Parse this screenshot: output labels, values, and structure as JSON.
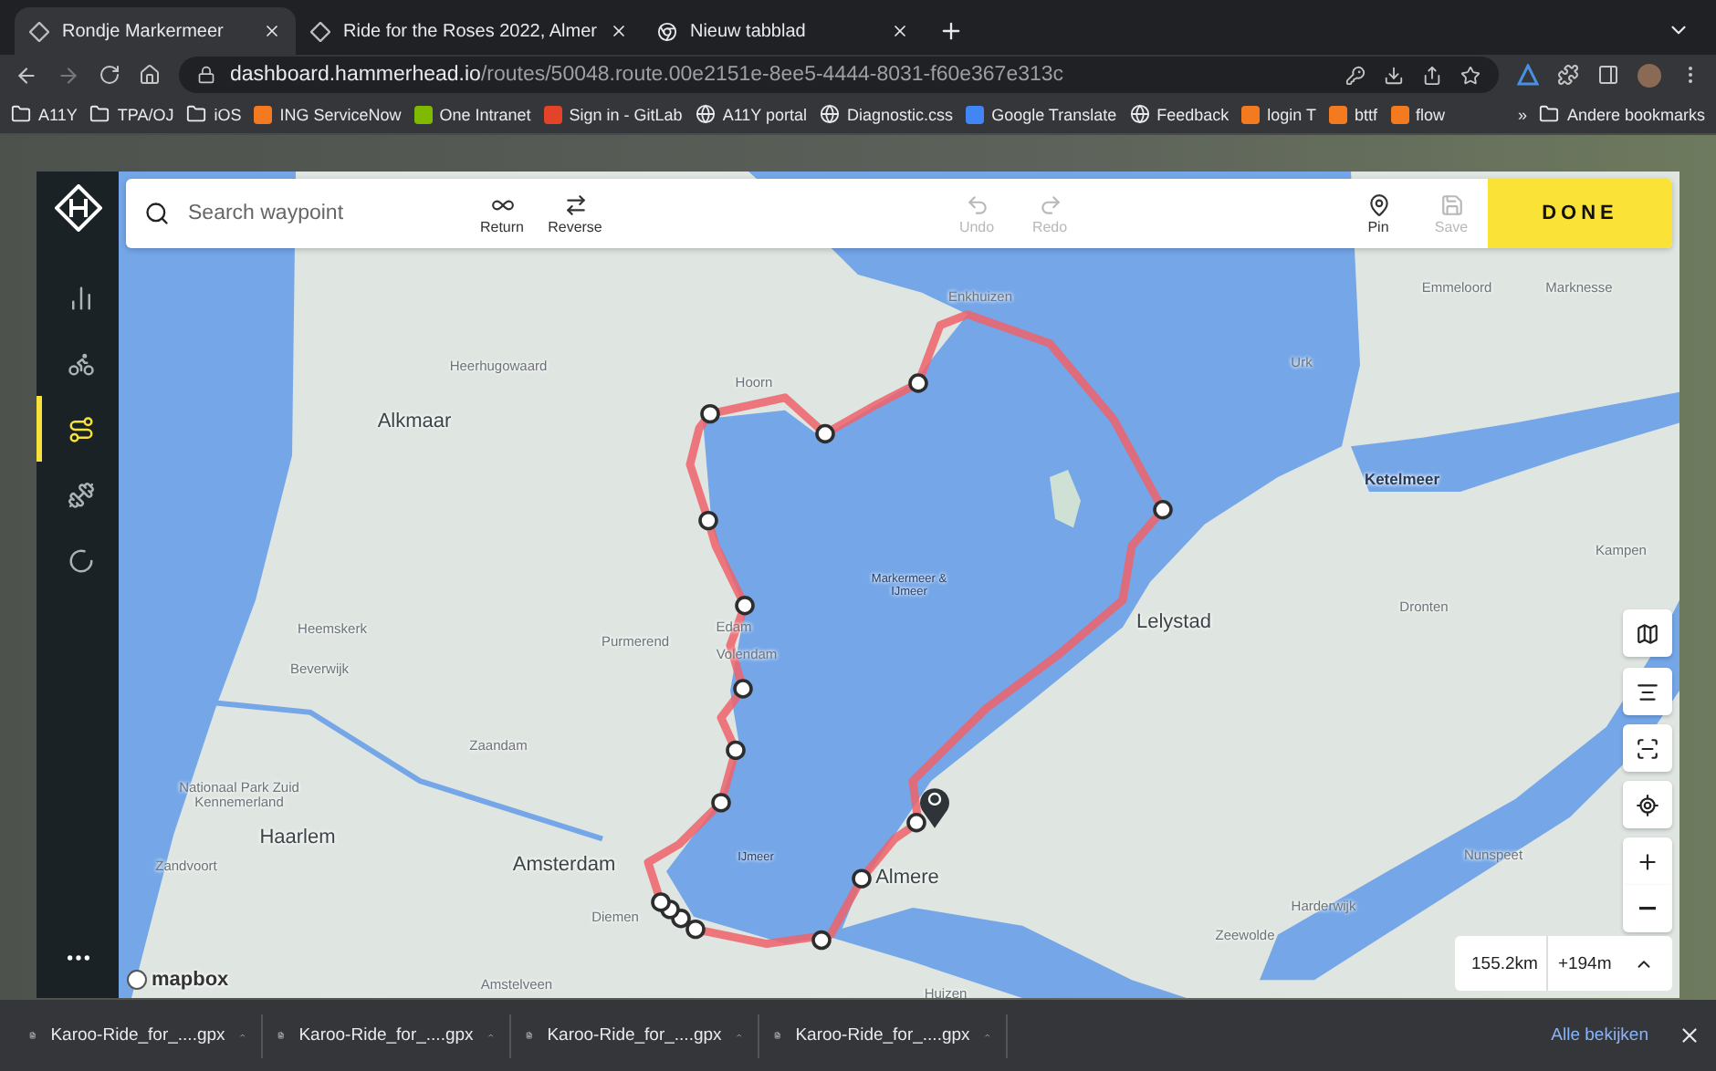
{
  "browser": {
    "tabs": [
      {
        "title": "Rondje Markermeer",
        "kind": "hammerhead",
        "selected": true
      },
      {
        "title": "Ride for the Roses 2022, Almer",
        "kind": "hammerhead",
        "selected": false
      },
      {
        "title": "Nieuw tabblad",
        "kind": "chrome",
        "selected": false
      }
    ],
    "url": {
      "host": "dashboard.hammerhead.io",
      "path": "/routes/50048.route.00e2151e-8ee5-4444-8031-f60e367e313c"
    },
    "bookmarks": [
      {
        "label": "A11Y",
        "kind": "folder"
      },
      {
        "label": "TPA/OJ",
        "kind": "folder"
      },
      {
        "label": "iOS",
        "kind": "folder"
      },
      {
        "label": "ING ServiceNow",
        "kind": "favicon",
        "color": "#f47a20"
      },
      {
        "label": "One Intranet",
        "kind": "favicon",
        "color": "#7fba00"
      },
      {
        "label": "Sign in - GitLab",
        "kind": "favicon",
        "color": "#e24329"
      },
      {
        "label": "A11Y portal",
        "kind": "globe"
      },
      {
        "label": "Diagnostic.css",
        "kind": "globe"
      },
      {
        "label": "Google Translate",
        "kind": "favicon",
        "color": "#4285f4"
      },
      {
        "label": "Feedback",
        "kind": "globe"
      },
      {
        "label": "login T",
        "kind": "favicon",
        "color": "#f47a20"
      },
      {
        "label": "bttf",
        "kind": "favicon",
        "color": "#f47a20"
      },
      {
        "label": "flow",
        "kind": "favicon",
        "color": "#f47a20"
      }
    ],
    "bookmarks_overflow": "»",
    "other_bookmarks": "Andere bookmarks"
  },
  "sidebar": {
    "items": [
      {
        "kind": "stats",
        "selected": false
      },
      {
        "kind": "bike",
        "selected": false
      },
      {
        "kind": "routes",
        "selected": true
      },
      {
        "kind": "workouts",
        "selected": false
      },
      {
        "kind": "progress",
        "selected": false
      }
    ]
  },
  "toolbar": {
    "search": {
      "placeholder": "Search waypoint"
    },
    "actions": [
      {
        "label": "Return",
        "kind": "return",
        "disabled": false
      },
      {
        "label": "Reverse",
        "kind": "reverse",
        "disabled": false
      },
      {
        "label": "Undo",
        "kind": "undo",
        "disabled": true
      },
      {
        "label": "Redo",
        "kind": "redo",
        "disabled": true
      },
      {
        "label": "Pin",
        "kind": "pin",
        "disabled": false
      },
      {
        "label": "Save",
        "kind": "save",
        "disabled": true
      }
    ],
    "done": "DONE"
  },
  "map": {
    "labels": [
      {
        "text": "Enkhuizen",
        "kind": "town"
      },
      {
        "text": "Emmeloord",
        "kind": "town"
      },
      {
        "text": "Marknesse",
        "kind": "town"
      },
      {
        "text": "Heerhugowaard",
        "kind": "town"
      },
      {
        "text": "Urk",
        "kind": "town"
      },
      {
        "text": "Hoorn",
        "kind": "town"
      },
      {
        "text": "Alkmaar",
        "kind": "city"
      },
      {
        "text": "Ketelmeer",
        "kind": "water"
      },
      {
        "text": "Kampen",
        "kind": "town"
      },
      {
        "text": "Markermeer & IJmeer",
        "kind": "lake"
      },
      {
        "text": "Heemskerk",
        "kind": "town"
      },
      {
        "text": "Purmerend",
        "kind": "town"
      },
      {
        "text": "Edam",
        "kind": "town"
      },
      {
        "text": "Volendam",
        "kind": "town"
      },
      {
        "text": "Lelystad",
        "kind": "city"
      },
      {
        "text": "Dronten",
        "kind": "town"
      },
      {
        "text": "Beverwijk",
        "kind": "town"
      },
      {
        "text": "Zaandam",
        "kind": "town"
      },
      {
        "text": "Nationaal Park Zuid Kennemerland",
        "kind": "town"
      },
      {
        "text": "Haarlem",
        "kind": "city"
      },
      {
        "text": "Zandvoort",
        "kind": "town"
      },
      {
        "text": "Amsterdam",
        "kind": "city"
      },
      {
        "text": "IJmeer",
        "kind": "lake"
      },
      {
        "text": "Nunspeet",
        "kind": "town"
      },
      {
        "text": "Almere",
        "kind": "city"
      },
      {
        "text": "Harderwijk",
        "kind": "town"
      },
      {
        "text": "Diemen",
        "kind": "town"
      },
      {
        "text": "Zeewolde",
        "kind": "town"
      },
      {
        "text": "Amstelveen",
        "kind": "town"
      },
      {
        "text": "Huizen",
        "kind": "town"
      }
    ],
    "attribution": "mapbox",
    "stats": {
      "distance": "155.2km",
      "elevation": "+194m"
    }
  },
  "downloads": {
    "items": [
      {
        "name": "Karoo-Ride_for_....gpx"
      },
      {
        "name": "Karoo-Ride_for_....gpx"
      },
      {
        "name": "Karoo-Ride_for_....gpx"
      },
      {
        "name": "Karoo-Ride_for_....gpx"
      }
    ],
    "show_all": "Alle bekijken"
  }
}
